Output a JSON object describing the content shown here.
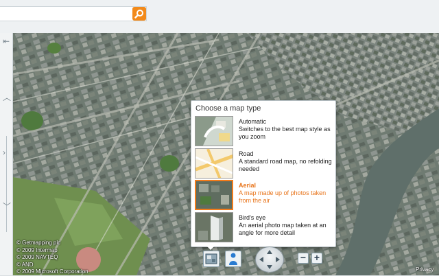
{
  "search": {
    "value": "",
    "placeholder": ""
  },
  "map_type_panel": {
    "title": "Choose a map type",
    "options": [
      {
        "title": "Automatic",
        "description": "Switches to the best map style as you zoom",
        "selected": false
      },
      {
        "title": "Road",
        "description": "A standard road map, no refolding needed",
        "selected": false
      },
      {
        "title": "Aerial",
        "description": "A map made up of photos taken from the air",
        "selected": true
      },
      {
        "title": "Bird's eye",
        "description": "An aerial photo map taken at an angle for more detail",
        "selected": false
      }
    ]
  },
  "credits": [
    "© Getmapping plc",
    "© 2009 Intermap",
    "© 2009 NAVTEQ",
    "© AND",
    "© 2009 Microsoft Corporation"
  ],
  "privacy": "Privacy",
  "zoom": {
    "out_label": "−",
    "in_label": "+"
  },
  "colors": {
    "accent": "#f27b1a",
    "selected_text": "#e8741a",
    "search_button": "#f28a1a",
    "river": "#5f6f6a"
  },
  "icons": {
    "search": "magnifier-icon",
    "map_type": "map-type-icon",
    "street_person": "person-icon",
    "navigation": "compass-icon",
    "rail_top": "collapse-arrow-icon",
    "rail_up": "chevron-up-icon",
    "rail_down": "chevron-down-icon"
  }
}
